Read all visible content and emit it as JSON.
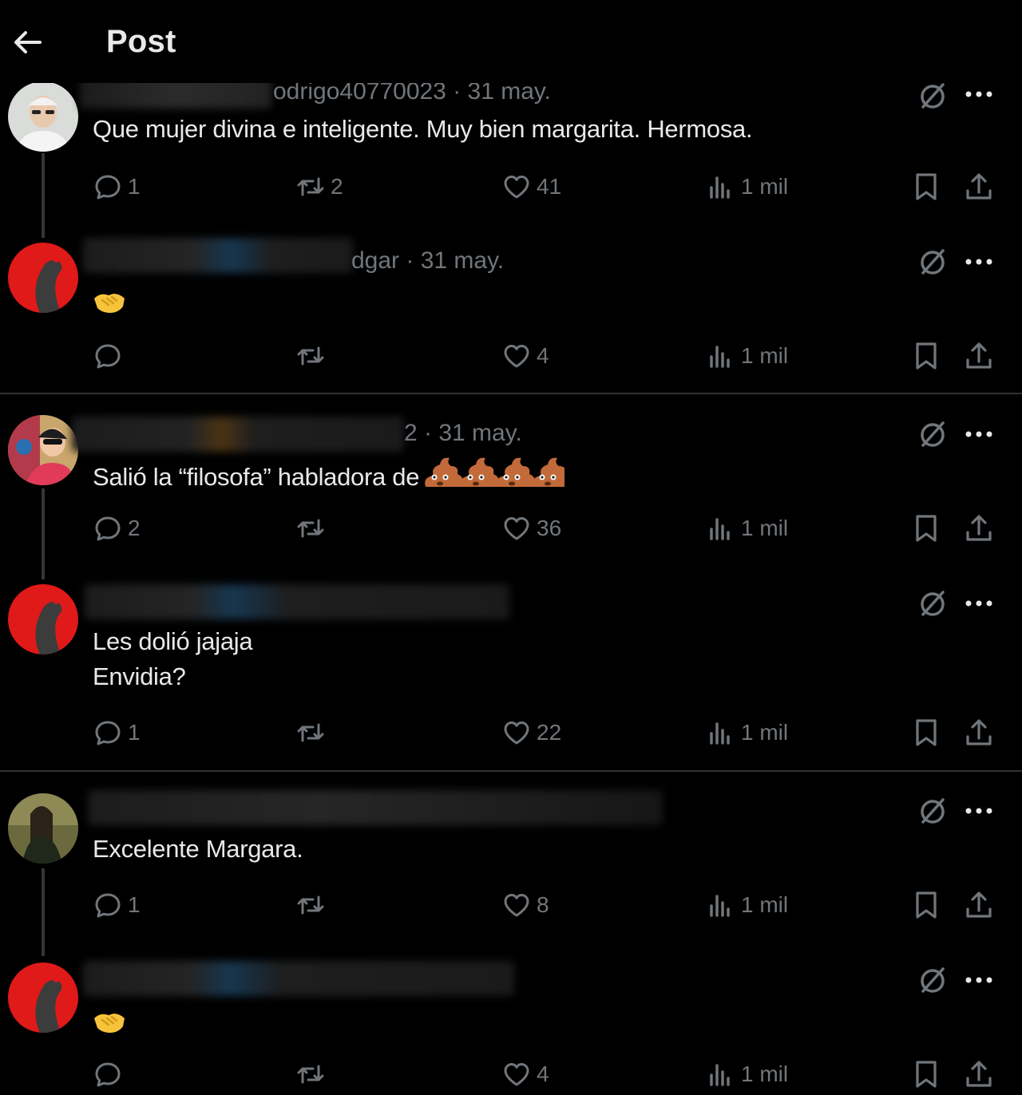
{
  "header": {
    "title": "Post",
    "back_icon": "arrow-left-icon"
  },
  "colors": {
    "background": "#000000",
    "text": "#e7e9ea",
    "muted": "#71767b",
    "divider": "#2f3336"
  },
  "posts": [
    {
      "handle_tail": "odrigo40770023 · 31 may.",
      "text": "Que mujer divina e inteligente. Muy bien margarita. Hermosa.",
      "stats": {
        "replies": "1",
        "reposts": "2",
        "likes": "41",
        "views": "1 mil"
      }
    },
    {
      "handle_tail": "dgar · 31 may.",
      "text": "",
      "emoji": "handshake",
      "stats": {
        "replies": "",
        "reposts": "",
        "likes": "4",
        "views": "1 mil"
      }
    },
    {
      "handle_tail": "2 · 31 may.",
      "text": "Salió la “filosofa” habladora de",
      "emoji": "pile-of-poo ×4",
      "stats": {
        "replies": "2",
        "reposts": "",
        "likes": "36",
        "views": "1 mil"
      }
    },
    {
      "handle_tail": "",
      "text": "Les dolió jajaja\nEnvidia?",
      "stats": {
        "replies": "1",
        "reposts": "",
        "likes": "22",
        "views": "1 mil"
      }
    },
    {
      "handle_tail": "",
      "text": "Excelente Margara.",
      "stats": {
        "replies": "1",
        "reposts": "",
        "likes": "8",
        "views": "1 mil"
      }
    },
    {
      "handle_tail": "",
      "text": "",
      "emoji": "handshake",
      "stats": {
        "replies": "",
        "reposts": "",
        "likes": "4",
        "views": "1 mil"
      }
    }
  ]
}
